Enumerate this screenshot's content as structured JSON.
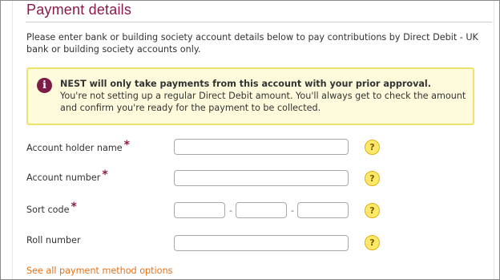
{
  "page": {
    "title": "Payment details",
    "intro": "Please enter bank or building society account details below to pay contributions by Direct Debit - UK bank or building society accounts only."
  },
  "notice": {
    "icon": "info-icon",
    "icon_glyph": "i",
    "heading": "NEST will only take payments from this account with your prior approval.",
    "body": "You're not setting up a regular Direct Debit amount. You'll always get to check the amount and confirm you're ready for the payment to be collected."
  },
  "form": {
    "required_marker": "*",
    "help_glyph": "?",
    "separator": "-",
    "account_holder": {
      "label": "Account holder name",
      "value": ""
    },
    "account_number": {
      "label": "Account number",
      "value": ""
    },
    "sort_code": {
      "label": "Sort code",
      "part1": "",
      "part2": "",
      "part3": ""
    },
    "roll_number": {
      "label": "Roll number",
      "value": ""
    }
  },
  "links": {
    "all_options": "See all payment method options"
  },
  "colors": {
    "brand": "#8b1a4a",
    "link": "#e0731d",
    "notice_bg": "#fefbdc",
    "notice_border": "#f0e26b",
    "help": "#ffe86a"
  }
}
